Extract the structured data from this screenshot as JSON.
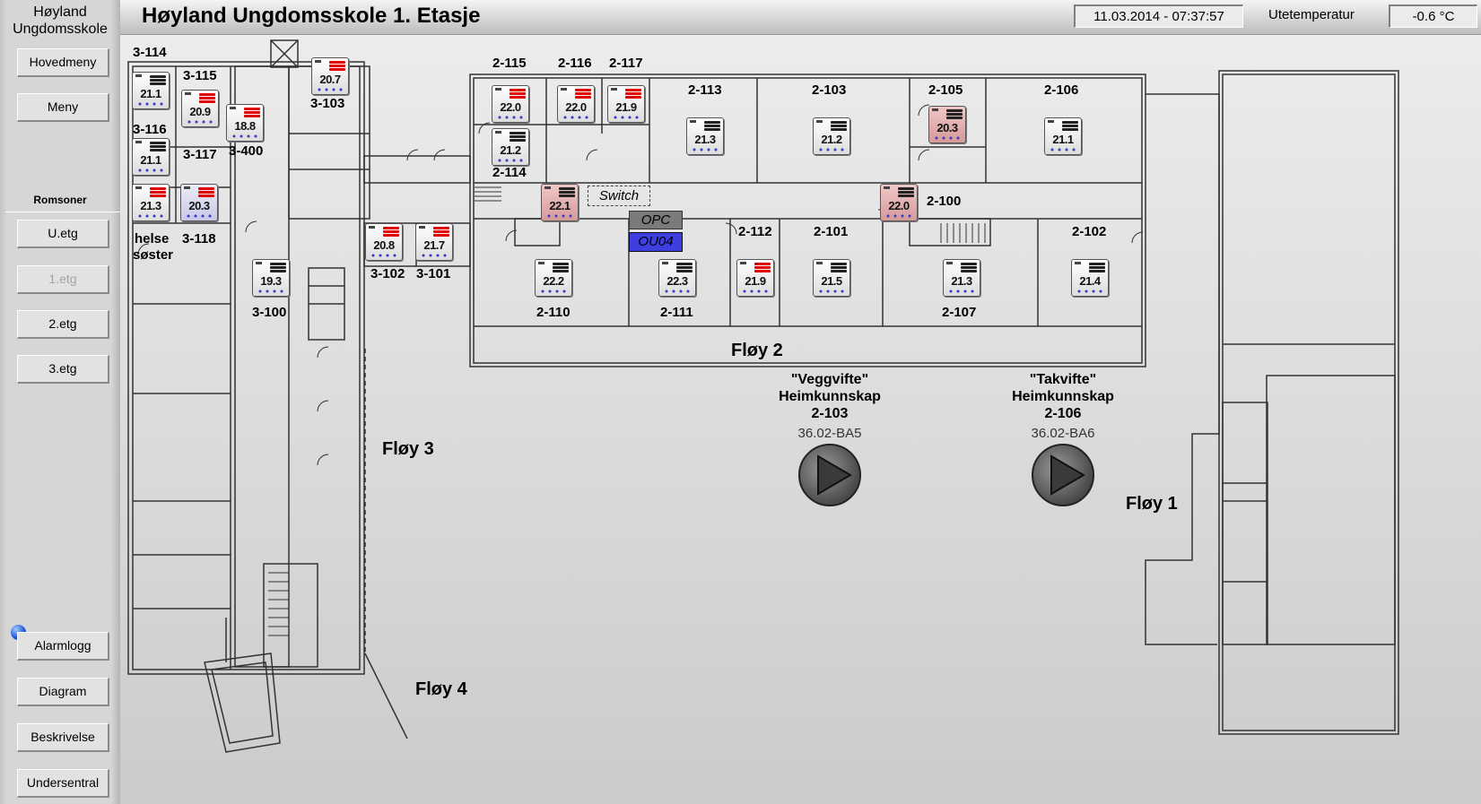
{
  "sidebar": {
    "title_line1": "Høyland",
    "title_line2": "Ungdomsskole",
    "hovedmeny": "Hovedmeny",
    "meny": "Meny",
    "rooms_heading": "Romsoner",
    "uetg": "U.etg",
    "etg1": "1.etg",
    "etg2": "2.etg",
    "etg3": "3.etg",
    "alarmlogg": "Alarmlogg",
    "diagram": "Diagram",
    "beskrivelse": "Beskrivelse",
    "undersentral": "Undersentral"
  },
  "header": {
    "title": "Høyland Ungdomsskole 1. Etasje",
    "datetime": "11.03.2014 - 07:37:57",
    "outdoor_label": "Utetemperatur",
    "outdoor_value": "-0.6 °C"
  },
  "rooms": {
    "r3114": "3-114",
    "r3115": "3-115",
    "r3116": "3-116",
    "r3117": "3-117",
    "r3400": "3-400",
    "r3103": "3-103",
    "r3118": "3-118",
    "helse1": "helse",
    "helse2": "søster",
    "r3102": "3-102",
    "r3101": "3-101",
    "r3100": "3-100",
    "r2115": "2-115",
    "r2116": "2-116",
    "r2117": "2-117",
    "r2113": "2-113",
    "r2103": "2-103",
    "r2105": "2-105",
    "r2106": "2-106",
    "r2114": "2-114",
    "r2100": "2-100",
    "r2112": "2-112",
    "r2101": "2-101",
    "r2102": "2-102",
    "r2110": "2-110",
    "r2111": "2-111",
    "r2107": "2-107"
  },
  "thermostats": {
    "t3114": "21.1",
    "t3115": "20.9",
    "t3116": "21.1",
    "t3400": "18.8",
    "t3103": "20.7",
    "t3118a": "21.3",
    "t3118b": "20.3",
    "t3102": "20.8",
    "t3101": "21.7",
    "t3100": "19.3",
    "t2115": "22.0",
    "t2116": "22.0",
    "t2117": "21.9",
    "t2113": "21.3",
    "t2103": "21.2",
    "t2105": "20.3",
    "t2106": "21.1",
    "t2114": "21.2",
    "tcorrW": "22.1",
    "tcorrE": "22.0",
    "t2110": "22.2",
    "t2111": "22.3",
    "t2112": "21.9",
    "t2101": "21.5",
    "t2107": "21.3",
    "t2102": "21.4"
  },
  "tags": {
    "switch": "Switch",
    "opc": "OPC",
    "ou04": "OU04"
  },
  "wings": {
    "floy1": "Fløy 1",
    "floy2": "Fløy 2",
    "floy3": "Fløy 3",
    "floy4": "Fløy 4"
  },
  "fans": {
    "fan1": {
      "name": "\"Veggvifte\"",
      "area": "Heimkunnskap",
      "room": "2-103",
      "tag": "36.02-BA5"
    },
    "fan2": {
      "name": "\"Takvifte\"",
      "area": "Heimkunnskap",
      "room": "2-106",
      "tag": "36.02-BA6"
    }
  },
  "colors": {
    "thermo_warm": "#d59a9a",
    "thermo_cool": "#c7c9e6",
    "tag_opc": "#7a7a7a",
    "tag_ou04": "#3f3fe0",
    "alarm": "#1a4fd6"
  }
}
